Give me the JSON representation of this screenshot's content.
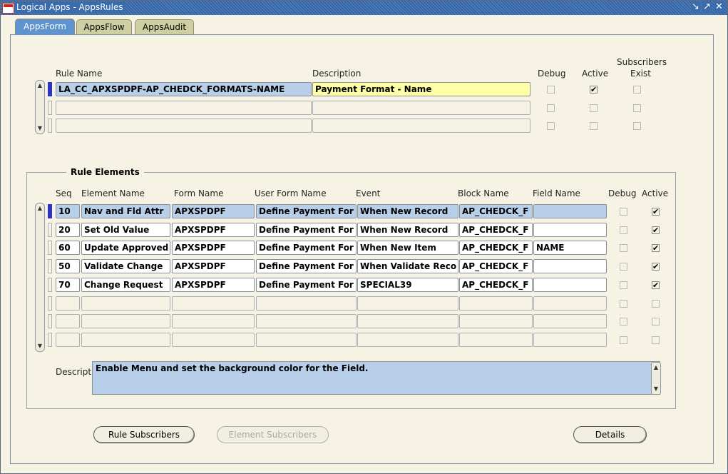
{
  "window": {
    "title": "Logical Apps - AppsRules"
  },
  "tabs": [
    {
      "label": "AppsForm"
    },
    {
      "label": "AppsFlow"
    },
    {
      "label": "AppsAudit"
    }
  ],
  "rules": {
    "headers": {
      "rule_name": "Rule Name",
      "description": "Description",
      "debug": "Debug",
      "active": "Active",
      "subscribers": "Subscribers",
      "exist": "Exist"
    },
    "rows": [
      {
        "rule_name": "LA_CC_APXSPDPF-AP_CHEDCK_FORMATS-NAME",
        "description": "Payment Format - Name",
        "debug": false,
        "active": true,
        "subscribers_exist": false
      },
      {
        "rule_name": "",
        "description": "",
        "debug": false,
        "active": false,
        "subscribers_exist": false
      },
      {
        "rule_name": "",
        "description": "",
        "debug": false,
        "active": false,
        "subscribers_exist": false
      }
    ]
  },
  "elements": {
    "group_label": "Rule Elements",
    "headers": {
      "seq": "Seq",
      "element_name": "Element Name",
      "form_name": "Form Name",
      "user_form_name": "User Form Name",
      "event": "Event",
      "block_name": "Block Name",
      "field_name": "Field Name",
      "debug": "Debug",
      "active": "Active"
    },
    "rows": [
      {
        "seq": "10",
        "element_name": "Nav and Fld Attr",
        "form_name": "APXSPDPF",
        "user_form_name": "Define Payment For",
        "event": "When New Record",
        "block_name": "AP_CHEDCK_F",
        "field_name": "",
        "debug": false,
        "active": true
      },
      {
        "seq": "20",
        "element_name": "Set Old Value",
        "form_name": "APXSPDPF",
        "user_form_name": "Define Payment For",
        "event": "When New Record",
        "block_name": "AP_CHEDCK_F",
        "field_name": "",
        "debug": false,
        "active": true
      },
      {
        "seq": "60",
        "element_name": "Update Approved",
        "form_name": "APXSPDPF",
        "user_form_name": "Define Payment For",
        "event": "When New Item",
        "block_name": "AP_CHEDCK_F",
        "field_name": "NAME",
        "debug": false,
        "active": true
      },
      {
        "seq": "50",
        "element_name": "Validate Change",
        "form_name": "APXSPDPF",
        "user_form_name": "Define Payment For",
        "event": "When Validate Reco",
        "block_name": "AP_CHEDCK_F",
        "field_name": "",
        "debug": false,
        "active": true
      },
      {
        "seq": "70",
        "element_name": "Change Request",
        "form_name": "APXSPDPF",
        "user_form_name": "Define Payment For",
        "event": "SPECIAL39",
        "block_name": "AP_CHEDCK_F",
        "field_name": "",
        "debug": false,
        "active": true
      },
      {
        "seq": "",
        "element_name": "",
        "form_name": "",
        "user_form_name": "",
        "event": "",
        "block_name": "",
        "field_name": "",
        "debug": false,
        "active": false
      },
      {
        "seq": "",
        "element_name": "",
        "form_name": "",
        "user_form_name": "",
        "event": "",
        "block_name": "",
        "field_name": "",
        "debug": false,
        "active": false
      },
      {
        "seq": "",
        "element_name": "",
        "form_name": "",
        "user_form_name": "",
        "event": "",
        "block_name": "",
        "field_name": "",
        "debug": false,
        "active": false
      }
    ],
    "description_label": "Description",
    "description_value": "Enable Menu and set the background color for the Field."
  },
  "buttons": {
    "rule_subscribers": "Rule Subscribers",
    "element_subscribers": "Element Subscribers",
    "details": "Details"
  },
  "icons": {
    "app": "oracle-app-icon",
    "minimize": "minimize-icon",
    "maximize": "maximize-icon",
    "close": "close-icon",
    "check": "checkmark-icon",
    "scroll_up": "arrow-up-icon",
    "scroll_down": "arrow-down-icon"
  },
  "colors": {
    "title_bar": "#3a6bab",
    "active_tab": "#5e93cf",
    "inactive_tab": "#cfcfa4",
    "current_field": "#ffffa8",
    "current_record": "#b7cfe8",
    "background": "#f7f3e4"
  }
}
